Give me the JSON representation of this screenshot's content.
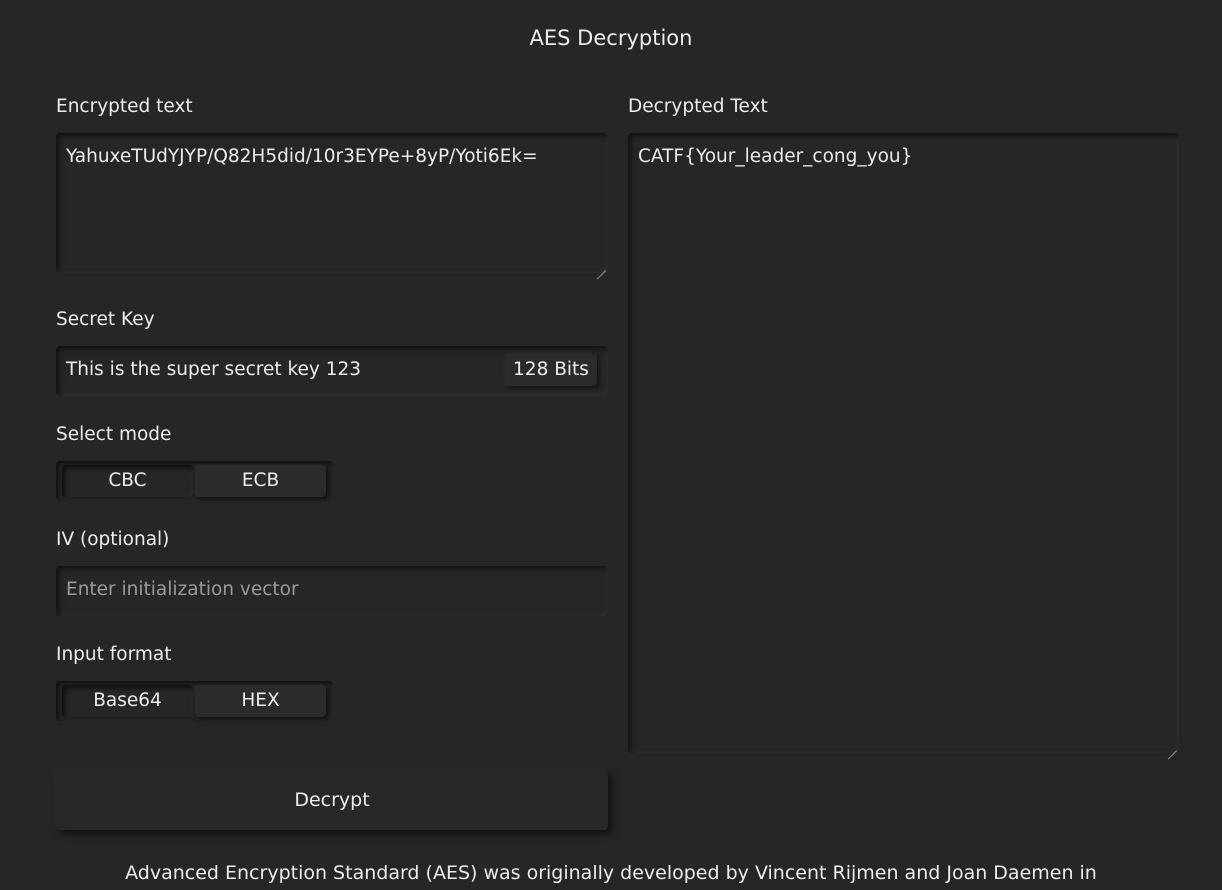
{
  "page": {
    "title": "AES Decryption"
  },
  "encrypted": {
    "label": "Encrypted text",
    "value": "YahuxeTUdYJYP/Q82H5did/10r3EYPe+8yP/Yoti6Ek="
  },
  "secret_key": {
    "label": "Secret Key",
    "value": "This is the super secret key 123",
    "bits_badge": "128 Bits"
  },
  "mode": {
    "label": "Select mode",
    "options": [
      "CBC",
      "ECB"
    ],
    "selected": "CBC"
  },
  "iv": {
    "label": "IV (optional)",
    "placeholder": "Enter initialization vector",
    "value": ""
  },
  "input_format": {
    "label": "Input format",
    "options": [
      "Base64",
      "HEX"
    ],
    "selected": "Base64"
  },
  "decrypt_button": {
    "label": "Decrypt"
  },
  "decrypted": {
    "label": "Decrypted Text",
    "value": "CATF{Your_leader_cong_you}"
  },
  "footer": {
    "text": "Advanced Encryption Standard (AES) was originally developed by Vincent Rijmen and Joan Daemen in"
  }
}
